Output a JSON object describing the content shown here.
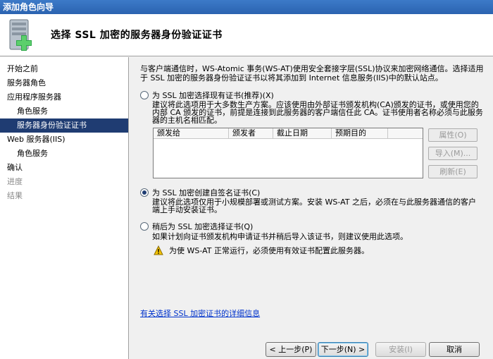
{
  "window": {
    "title": "添加角色向导"
  },
  "header": {
    "title": "选择 SSL 加密的服务器身份验证证书"
  },
  "sidebar": {
    "items": [
      {
        "label": "开始之前",
        "level": 0,
        "state": "normal"
      },
      {
        "label": "服务器角色",
        "level": 0,
        "state": "normal"
      },
      {
        "label": "应用程序服务器",
        "level": 0,
        "state": "normal"
      },
      {
        "label": "角色服务",
        "level": 1,
        "state": "normal"
      },
      {
        "label": "服务器身份验证证书",
        "level": 1,
        "state": "active"
      },
      {
        "label": "Web 服务器(IIS)",
        "level": 0,
        "state": "normal"
      },
      {
        "label": "角色服务",
        "level": 1,
        "state": "normal"
      },
      {
        "label": "确认",
        "level": 0,
        "state": "normal"
      },
      {
        "label": "进度",
        "level": 0,
        "state": "disabled"
      },
      {
        "label": "结果",
        "level": 0,
        "state": "disabled"
      }
    ]
  },
  "main": {
    "intro": "与客户端通信时，WS-Atomic 事务(WS-AT)使用安全套接字层(SSL)协议来加密网络通信。选择适用于 SSL 加密的服务器身份验证证书以将其添加到 Internet 信息服务(IIS)中的默认站点。",
    "option_existing": {
      "label": "为 SSL 加密选择现有证书(推荐)(X)",
      "checked": false,
      "desc": "建议将此选项用于大多数生产方案。应该使用由外部证书颁发机构(CA)颁发的证书，或使用您的内部 CA 颁发的证书，前提是连接到此服务器的客户端信任此 CA。证书使用者名称必须与此服务器的主机名相匹配。"
    },
    "cert_table": {
      "columns": [
        "颁发给",
        "颁发者",
        "截止日期",
        "预期目的"
      ]
    },
    "cert_buttons": {
      "properties": "属性(O)",
      "import": "导入(M)...",
      "refresh": "刷新(E)"
    },
    "option_selfsigned": {
      "label": "为 SSL 加密创建自签名证书(C)",
      "checked": true,
      "desc": "建议将此选项仅用于小规模部署或测试方案。安装 WS-AT 之后，必须在与此服务器通信的客户端上手动安装证书。"
    },
    "option_later": {
      "label": "稍后为 SSL 加密选择证书(Q)",
      "checked": false,
      "desc": "如果计划向证书颁发机构申请证书并稍后导入该证书，则建议使用此选项。",
      "warning": "为使 WS-AT 正常运行，必须使用有效证书配置此服务器。"
    },
    "more_info_link": "有关选择 SSL 加密证书的详细信息"
  },
  "footer": {
    "back": "< 上一步(P)",
    "next": "下一步(N) >",
    "install": "安装(I)",
    "cancel": "取消"
  },
  "colors": {
    "active_nav": "#1f3c72",
    "link": "#0033cc",
    "titlebar": "#2b63b0"
  }
}
